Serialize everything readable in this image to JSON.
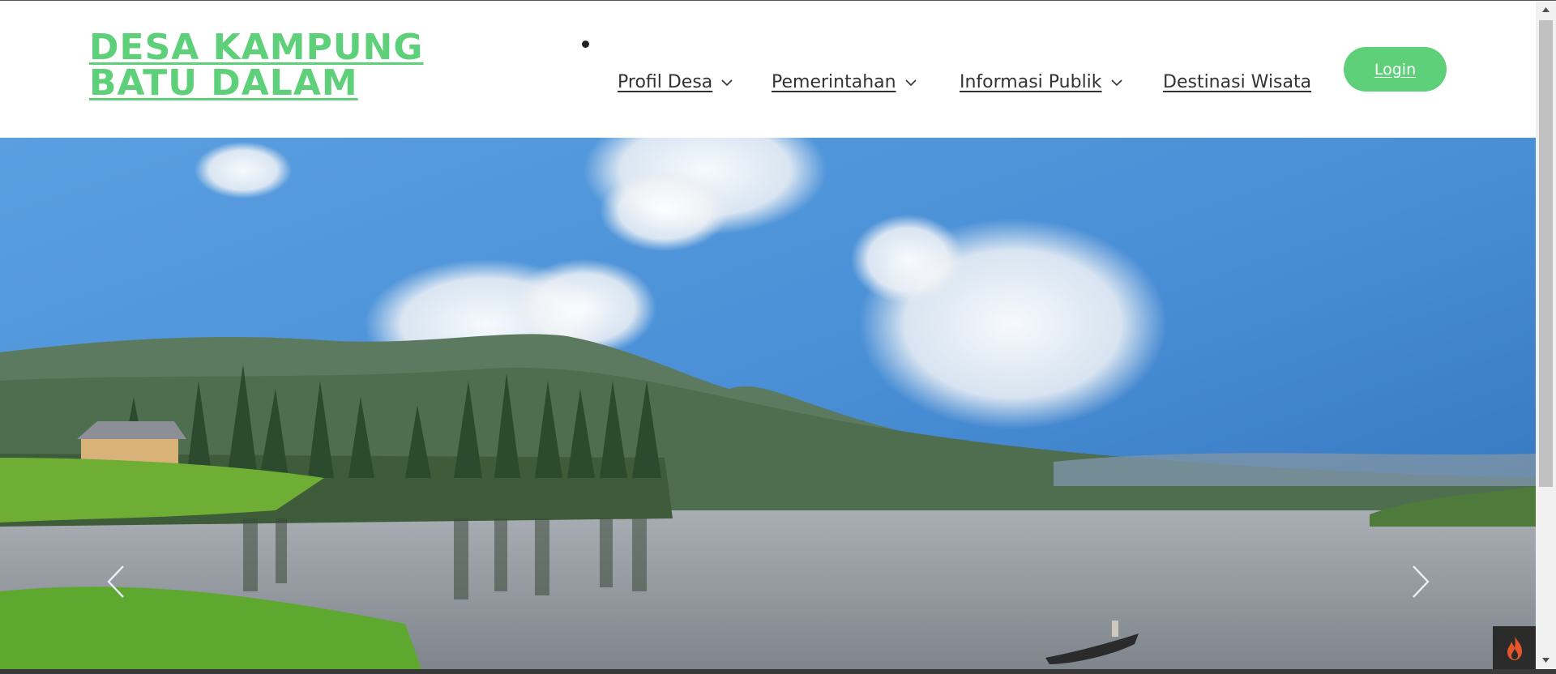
{
  "header": {
    "brand": "DESA KAMPUNG BATU DALAM",
    "nav": [
      {
        "label": "Profil Desa",
        "has_dropdown": true
      },
      {
        "label": "Pemerintahan",
        "has_dropdown": true
      },
      {
        "label": "Informasi Publik",
        "has_dropdown": true
      },
      {
        "label": "Destinasi Wisata",
        "has_dropdown": false
      }
    ],
    "login_label": "Login"
  },
  "hero": {
    "image": "lake-mountain-landscape",
    "prev_icon": "chevron-left-icon",
    "next_icon": "chevron-right-icon"
  },
  "colors": {
    "brand_green": "#5fd07a",
    "nav_text": "#333333",
    "sky": "#3f86cf",
    "lake": "#8f959c"
  },
  "icons": {
    "dropdown": "chevron-down-icon",
    "debug_toolbar": "flame-icon"
  }
}
